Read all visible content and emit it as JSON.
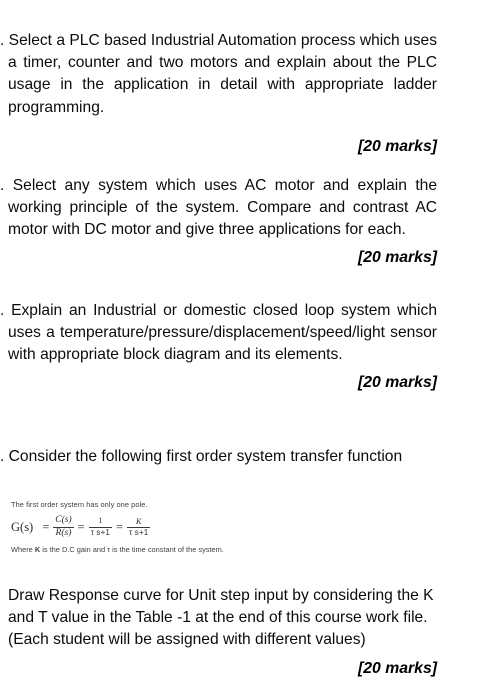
{
  "document": {
    "type": "coursework-question-sheet",
    "background_color": "#ffffff",
    "text_color": "#0b0b0b"
  },
  "questions": [
    {
      "id": "q1",
      "body": ". Select a PLC based Industrial Automation process which uses a timer, counter and two motors and explain about the PLC usage in the application in detail with appropriate ladder programming.",
      "marks": "[20 marks]"
    },
    {
      "id": "q2",
      "body": ". Select any system which uses AC motor and explain the working principle of the system. Compare and contrast AC motor with DC motor and give three applications for each.",
      "marks": "[20 marks]"
    },
    {
      "id": "q3",
      "body": ". Explain an Industrial or domestic closed loop system which uses a temperature/pressure/displacement/speed/light sensor with appropriate block diagram and its elements.",
      "marks": "[20 marks]"
    },
    {
      "id": "q4",
      "body": ". Consider the following first order system transfer function",
      "marks": "[20 marks]",
      "tail": "Draw Response curve for Unit step input by considering the K and T value in the Table -1 at the end of this course work file. (Each student will be assigned with different values)"
    }
  ],
  "formula_figure": {
    "caption": "The first order system has only one pole.",
    "lhs": "G(s)",
    "equals_1": "=",
    "equals_2": "=",
    "equals_3": "=",
    "frac1_num": "C(s)",
    "frac1_den": "R(s)",
    "frac2_num": "1",
    "frac2_den": "τ s+1",
    "frac3_num": "K",
    "frac3_den": "τ s+1",
    "note_prefix": "Where ",
    "note_symbol": "K",
    "note_suffix": " is the D.C gain and τ  is the time constant of the system."
  }
}
